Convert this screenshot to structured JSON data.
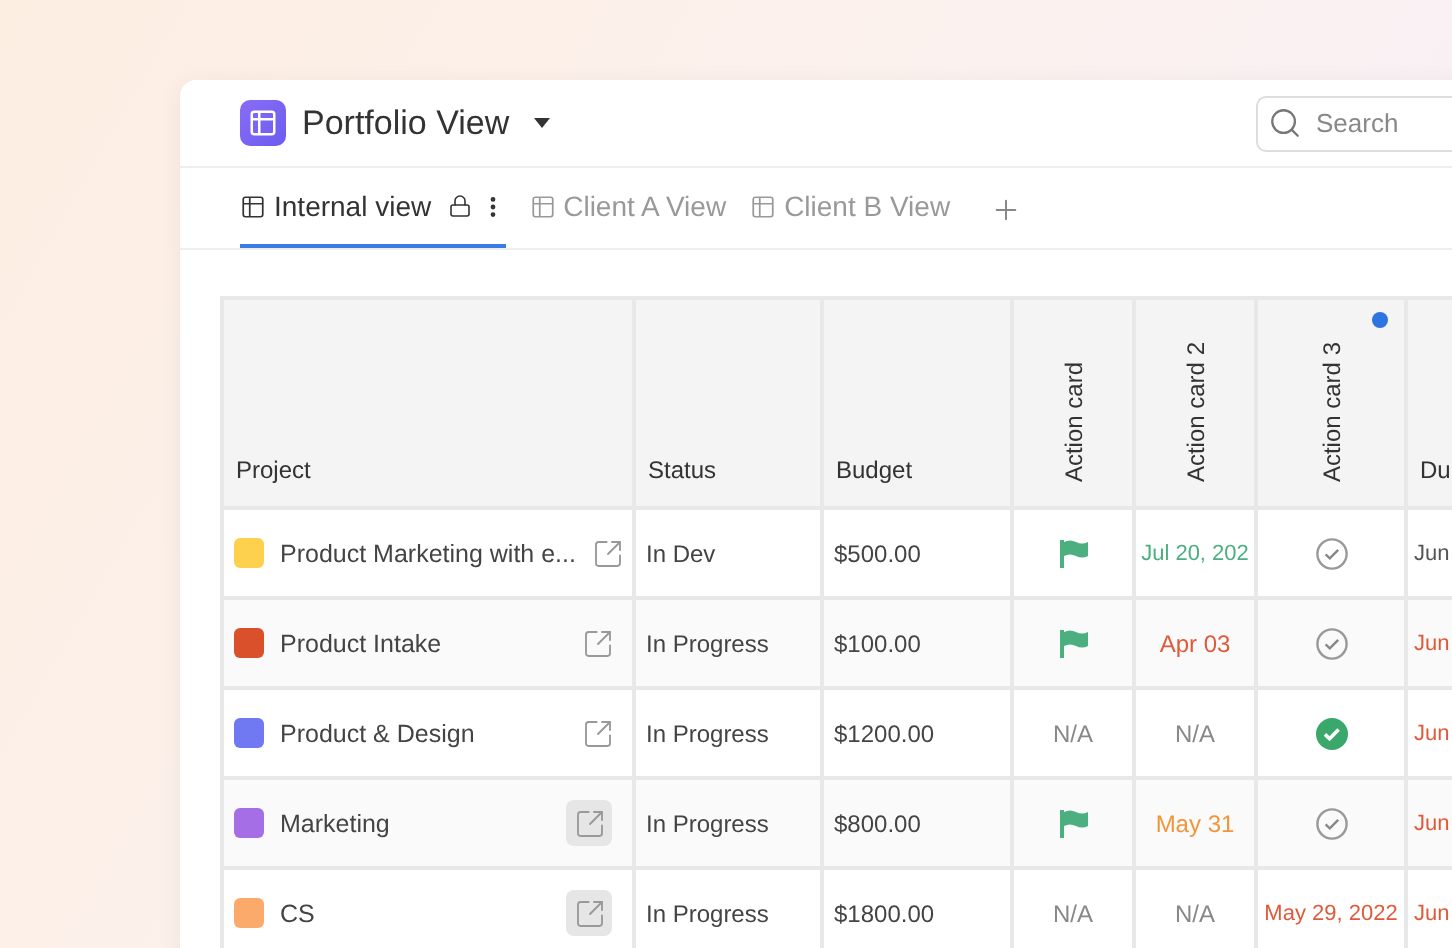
{
  "header": {
    "title": "Portfolio View",
    "search": {
      "placeholder": "Search"
    }
  },
  "tabs": [
    {
      "label": "Internal view",
      "selected": true,
      "locked": true
    },
    {
      "label": "Client A View",
      "selected": false,
      "locked": false
    },
    {
      "label": "Client B View",
      "selected": false,
      "locked": false
    }
  ],
  "table": {
    "columns": [
      {
        "label": "Project",
        "kind": "plain",
        "dot": false
      },
      {
        "label": "Status",
        "kind": "plain",
        "dot": false
      },
      {
        "label": "Budget",
        "kind": "plain",
        "dot": false
      },
      {
        "label": "Action card",
        "kind": "vertical",
        "dot": false
      },
      {
        "label": "Action card 2",
        "kind": "vertical",
        "dot": false
      },
      {
        "label": "Action card 3",
        "kind": "vertical",
        "dot": true
      },
      {
        "label": "Du",
        "kind": "plain",
        "dot": false
      }
    ],
    "rows": [
      {
        "cells": [
          {
            "kind": "project",
            "text": "Product Marketing with e...",
            "color": "#fdd04d",
            "link_highlighted": false
          },
          {
            "kind": "text",
            "text": "In Dev"
          },
          {
            "kind": "text",
            "text": "$500.00"
          },
          {
            "kind": "flag"
          },
          {
            "kind": "date",
            "text": "Jul 20, 202",
            "color": "#4caf80"
          },
          {
            "kind": "check",
            "done": false
          },
          {
            "kind": "date",
            "text": "Jun",
            "color": "#555555"
          }
        ]
      },
      {
        "cells": [
          {
            "kind": "project",
            "text": "Product Intake",
            "color": "#d9502b",
            "link_highlighted": false
          },
          {
            "kind": "text",
            "text": "In Progress"
          },
          {
            "kind": "text",
            "text": "$100.00"
          },
          {
            "kind": "flag"
          },
          {
            "kind": "date",
            "text": "Apr 03",
            "color": "#e05a3a"
          },
          {
            "kind": "check",
            "done": false
          },
          {
            "kind": "date",
            "text": "Jun",
            "color": "#e05a3a"
          }
        ]
      },
      {
        "cells": [
          {
            "kind": "project",
            "text": "Product & Design",
            "color": "#7079f2",
            "link_highlighted": false
          },
          {
            "kind": "text",
            "text": "In Progress"
          },
          {
            "kind": "text",
            "text": "$1200.00"
          },
          {
            "kind": "na",
            "text": "N/A"
          },
          {
            "kind": "na",
            "text": "N/A"
          },
          {
            "kind": "check",
            "done": true
          },
          {
            "kind": "date",
            "text": "Jun",
            "color": "#e05a3a"
          }
        ]
      },
      {
        "cells": [
          {
            "kind": "project",
            "text": "Marketing",
            "color": "#a66ee6",
            "link_highlighted": true
          },
          {
            "kind": "text",
            "text": "In Progress"
          },
          {
            "kind": "text",
            "text": "$800.00"
          },
          {
            "kind": "flag"
          },
          {
            "kind": "date",
            "text": "May 31",
            "color": "#f0963a"
          },
          {
            "kind": "check",
            "done": false
          },
          {
            "kind": "date",
            "text": "Jun",
            "color": "#e05a3a"
          }
        ]
      },
      {
        "cells": [
          {
            "kind": "project",
            "text": "CS",
            "color": "#fbaa6c",
            "link_highlighted": true
          },
          {
            "kind": "text",
            "text": "In Progress"
          },
          {
            "kind": "text",
            "text": "$1800.00"
          },
          {
            "kind": "na",
            "text": "N/A"
          },
          {
            "kind": "na",
            "text": "N/A"
          },
          {
            "kind": "date",
            "text": "May 29, 2022",
            "color": "#e05a3a"
          },
          {
            "kind": "date",
            "text": "Jun",
            "color": "#e05a3a"
          }
        ]
      }
    ]
  }
}
